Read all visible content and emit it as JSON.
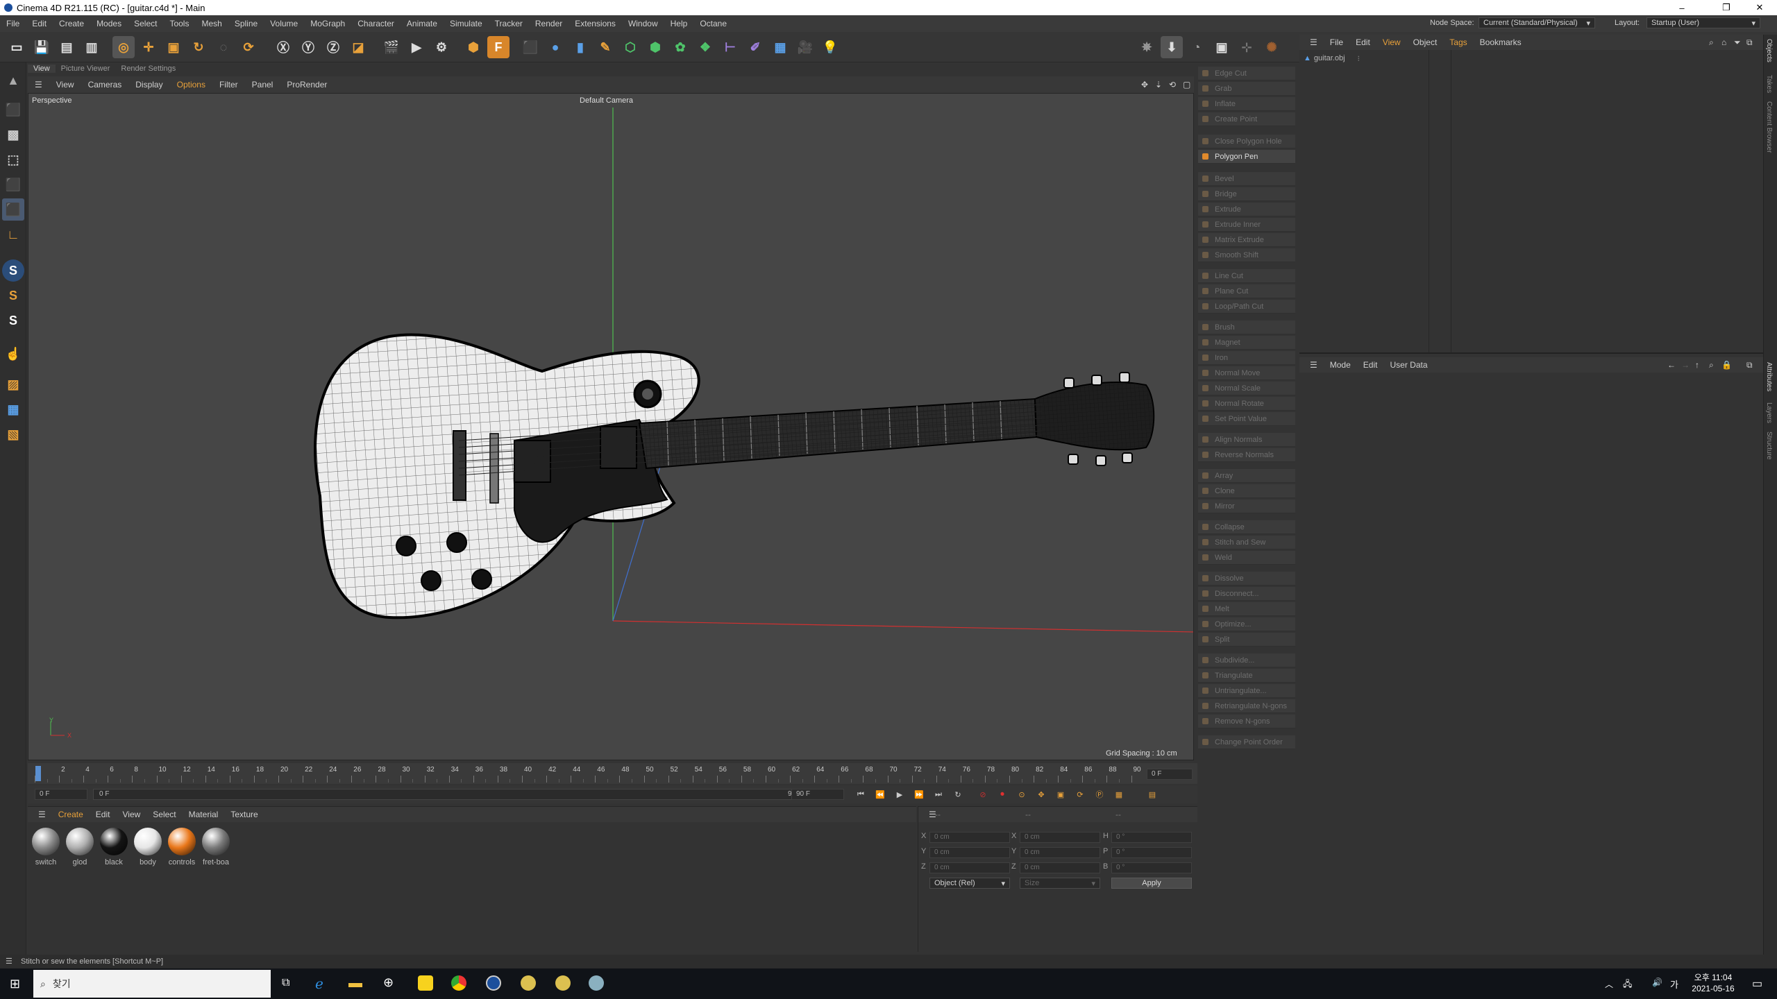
{
  "window": {
    "title": "Cinema 4D R21.115 (RC) - [guitar.c4d *] - Main",
    "min": "–",
    "max": "❐",
    "close": "✕"
  },
  "menu": [
    "File",
    "Edit",
    "Create",
    "Modes",
    "Select",
    "Tools",
    "Mesh",
    "Spline",
    "Volume",
    "MoGraph",
    "Character",
    "Animate",
    "Simulate",
    "Tracker",
    "Render",
    "Extensions",
    "Window",
    "Help",
    "Octane"
  ],
  "nodespace": {
    "label": "Node Space:",
    "value": "Current (Standard/Physical)"
  },
  "layout": {
    "label": "Layout:",
    "value": "Startup (User)"
  },
  "viewport_tabs": [
    "View",
    "Picture Viewer",
    "Render Settings"
  ],
  "viewport_menu": [
    "View",
    "Cameras",
    "Display",
    "Options",
    "Filter",
    "Panel",
    "ProRender"
  ],
  "viewport": {
    "label": "Perspective",
    "camera": "Default Camera",
    "grid_spacing": "Grid Spacing : 10 cm",
    "axis_y": "Y",
    "axis_x": "X"
  },
  "commands": [
    {
      "label": "Edge Cut",
      "active": false
    },
    {
      "label": "Grab",
      "active": false
    },
    {
      "label": "Inflate",
      "active": false
    },
    {
      "label": "Create Point",
      "active": false
    },
    {
      "label": "Close Polygon Hole",
      "active": false
    },
    {
      "label": "Polygon Pen",
      "active": true
    },
    {
      "label": "Bevel",
      "active": false
    },
    {
      "label": "Bridge",
      "active": false
    },
    {
      "label": "Extrude",
      "active": false
    },
    {
      "label": "Extrude Inner",
      "active": false
    },
    {
      "label": "Matrix Extrude",
      "active": false
    },
    {
      "label": "Smooth Shift",
      "active": false
    },
    {
      "label": "Line Cut",
      "active": false
    },
    {
      "label": "Plane Cut",
      "active": false
    },
    {
      "label": "Loop/Path Cut",
      "active": false
    },
    {
      "label": "Brush",
      "active": false
    },
    {
      "label": "Magnet",
      "active": false
    },
    {
      "label": "Iron",
      "active": false
    },
    {
      "label": "Normal Move",
      "active": false
    },
    {
      "label": "Normal Scale",
      "active": false
    },
    {
      "label": "Normal Rotate",
      "active": false
    },
    {
      "label": "Set Point Value",
      "active": false
    },
    {
      "label": "Align Normals",
      "active": false
    },
    {
      "label": "Reverse Normals",
      "active": false
    },
    {
      "label": "Array",
      "active": false
    },
    {
      "label": "Clone",
      "active": false
    },
    {
      "label": "Mirror",
      "active": false
    },
    {
      "label": "Collapse",
      "active": false
    },
    {
      "label": "Stitch and Sew",
      "active": false
    },
    {
      "label": "Weld",
      "active": false
    },
    {
      "label": "Dissolve",
      "active": false
    },
    {
      "label": "Disconnect...",
      "active": false
    },
    {
      "label": "Melt",
      "active": false
    },
    {
      "label": "Optimize...",
      "active": false
    },
    {
      "label": "Split",
      "active": false
    },
    {
      "label": "Subdivide...",
      "active": false
    },
    {
      "label": "Triangulate",
      "active": false
    },
    {
      "label": "Untriangulate...",
      "active": false
    },
    {
      "label": "Retriangulate N-gons",
      "active": false
    },
    {
      "label": "Remove N-gons",
      "active": false
    },
    {
      "label": "Change Point Order",
      "active": false
    }
  ],
  "objmgr": {
    "menu": [
      "File",
      "Edit",
      "View",
      "Object",
      "Tags",
      "Bookmarks"
    ],
    "objects": [
      "guitar.obj"
    ]
  },
  "attrmgr": {
    "menu": [
      "Mode",
      "Edit",
      "User Data"
    ]
  },
  "side_tabs": [
    "Objects",
    "Takes",
    "Content Browser",
    "Attributes",
    "Layers",
    "Structure"
  ],
  "timeline": {
    "ticks": [
      "0",
      "2",
      "4",
      "6",
      "8",
      "10",
      "12",
      "14",
      "16",
      "18",
      "20",
      "22",
      "24",
      "26",
      "28",
      "30",
      "32",
      "34",
      "36",
      "38",
      "40",
      "42",
      "44",
      "46",
      "48",
      "50",
      "52",
      "54",
      "56",
      "58",
      "60",
      "62",
      "64",
      "66",
      "68",
      "70",
      "72",
      "74",
      "76",
      "78",
      "80",
      "82",
      "84",
      "86",
      "88",
      "90"
    ],
    "frame_end_display": "0 F"
  },
  "transport": {
    "start": "0 F",
    "current": "0 F",
    "end": "90 F",
    "max": "90 F"
  },
  "matmgr": {
    "menu": [
      "Create",
      "Edit",
      "View",
      "Select",
      "Material",
      "Texture"
    ],
    "materials": [
      {
        "name": "switch",
        "color": "#8a8a8a"
      },
      {
        "name": "glod",
        "color": "#b0b0b0"
      },
      {
        "name": "black",
        "color": "#141414"
      },
      {
        "name": "body",
        "color": "#e6e6e6"
      },
      {
        "name": "controls",
        "color": "#e9771a"
      },
      {
        "name": "fret-boa",
        "color": "#7a7a7a"
      }
    ]
  },
  "coords": {
    "header": "--",
    "x": "0 cm",
    "y": "0 cm",
    "z": "0 cm",
    "sx": "0 cm",
    "sy": "0 cm",
    "sz": "0 cm",
    "h": "0 °",
    "p": "0 °",
    "b": "0 °",
    "lx": "X",
    "ly": "Y",
    "lz": "Z",
    "lsx": "X",
    "lsy": "Y",
    "lsz": "Z",
    "lh": "H",
    "lp": "P",
    "lb": "B",
    "mode": "Object (Rel)",
    "size": "Size",
    "apply": "Apply"
  },
  "status": "Stitch or sew the elements [Shortcut M~P]",
  "taskbar": {
    "search": "찾기",
    "time": "오후 11:04",
    "date": "2021-05-16",
    "lang": "가"
  }
}
